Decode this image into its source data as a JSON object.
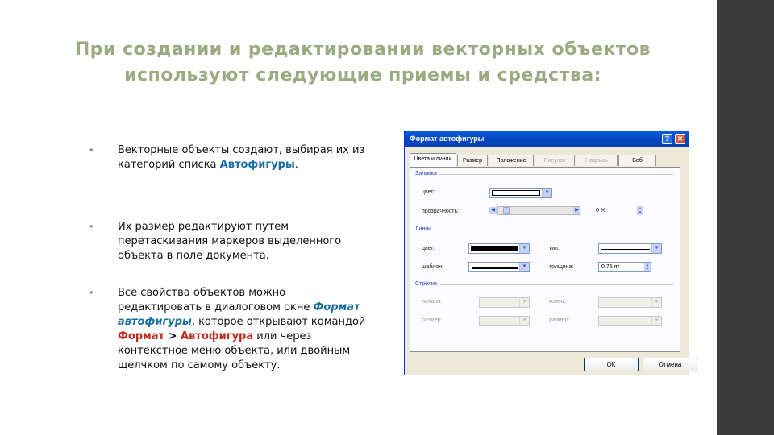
{
  "slide": {
    "title_line1": "При создании и редактировании векторных объектов",
    "title_line2": "используют следующие приемы и средства:",
    "bullet_symbol": "•",
    "bullet1": {
      "text": "Векторные объекты создают, выбирая их из категорий списка ",
      "highlight": "Автофигуры",
      "end": "."
    },
    "bullet2": {
      "text": "Их размер редактируют путем перетаскивания маркеров выделенного объекта в поле документа."
    },
    "bullet3": {
      "text1": "Все свойства объектов можно редактировать в диалоговом окне ",
      "highlight1": "Формат автофигуры",
      "text2": ", которое открывают командой ",
      "highlight2": "Формат",
      "sep": " > ",
      "highlight3": "Автофигура",
      "text3": " или через контекстное меню объекта, или двойным щелчком по самому объекту."
    }
  },
  "dialog": {
    "title": "Формат автофигуры",
    "help_button": "?",
    "close_button": "✕",
    "tabs": [
      "Цвета и линии",
      "Размер",
      "Положение",
      "Рисунок",
      "Надпись",
      "Веб"
    ],
    "fill": {
      "group_label": "Заливка",
      "color_label": "цвет:",
      "transparency_label": "прозрачность:",
      "transparency_value": "0 %"
    },
    "lines": {
      "group_label": "Линии",
      "color_label": "цвет:",
      "type_label": "тип:",
      "pattern_label": "шаблон:",
      "thickness_label": "толщина:",
      "thickness_value": "0,75 пт"
    },
    "arrows": {
      "group_label": "Стрелки",
      "start_label": "начало:",
      "end_label": "конец:",
      "start_size_label": "размер:",
      "end_size_label": "размер:"
    },
    "ok_label": "ОК",
    "cancel_label": "Отмена"
  },
  "colors": {
    "title": "#9aab82",
    "highlight_blue": "#1d6fa0",
    "highlight_red": "#c0281e",
    "sidebar": "#3a3a3a"
  }
}
